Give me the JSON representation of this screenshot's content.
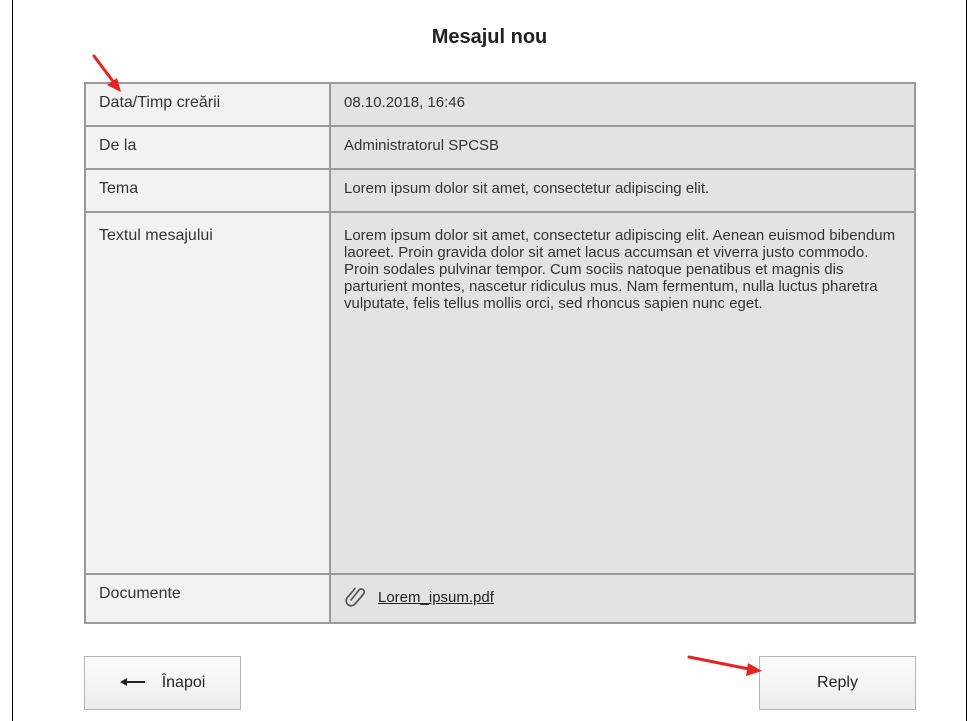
{
  "page": {
    "title": "Mesajul nou"
  },
  "message": {
    "rows": [
      {
        "label": "Data/Timp creării",
        "value": "08.10.2018, 16:46"
      },
      {
        "label": "De la",
        "value": "Administratorul SPCSB"
      },
      {
        "label": "Tema",
        "value": "Lorem ipsum dolor sit amet, consectetur adipiscing elit."
      },
      {
        "label": "Textul mesajului",
        "value": "Lorem ipsum dolor sit amet, consectetur adipiscing elit. Aenean euismod bibendum laoreet. Proin gravida dolor sit amet lacus accumsan et viverra justo commodo. Proin sodales pulvinar tempor. Cum sociis natoque penatibus et magnis dis parturient montes, nascetur ridiculus mus. Nam fermentum, nulla luctus pharetra vulputate, felis tellus mollis orci, sed rhoncus sapien nunc eget."
      },
      {
        "label": "Documente",
        "value": "Lorem_ipsum.pdf",
        "icon": "paperclip-icon"
      }
    ]
  },
  "buttons": {
    "back": "Înapoi",
    "reply": "Reply"
  },
  "annotations": {
    "arrow_color": "#e8231e"
  }
}
